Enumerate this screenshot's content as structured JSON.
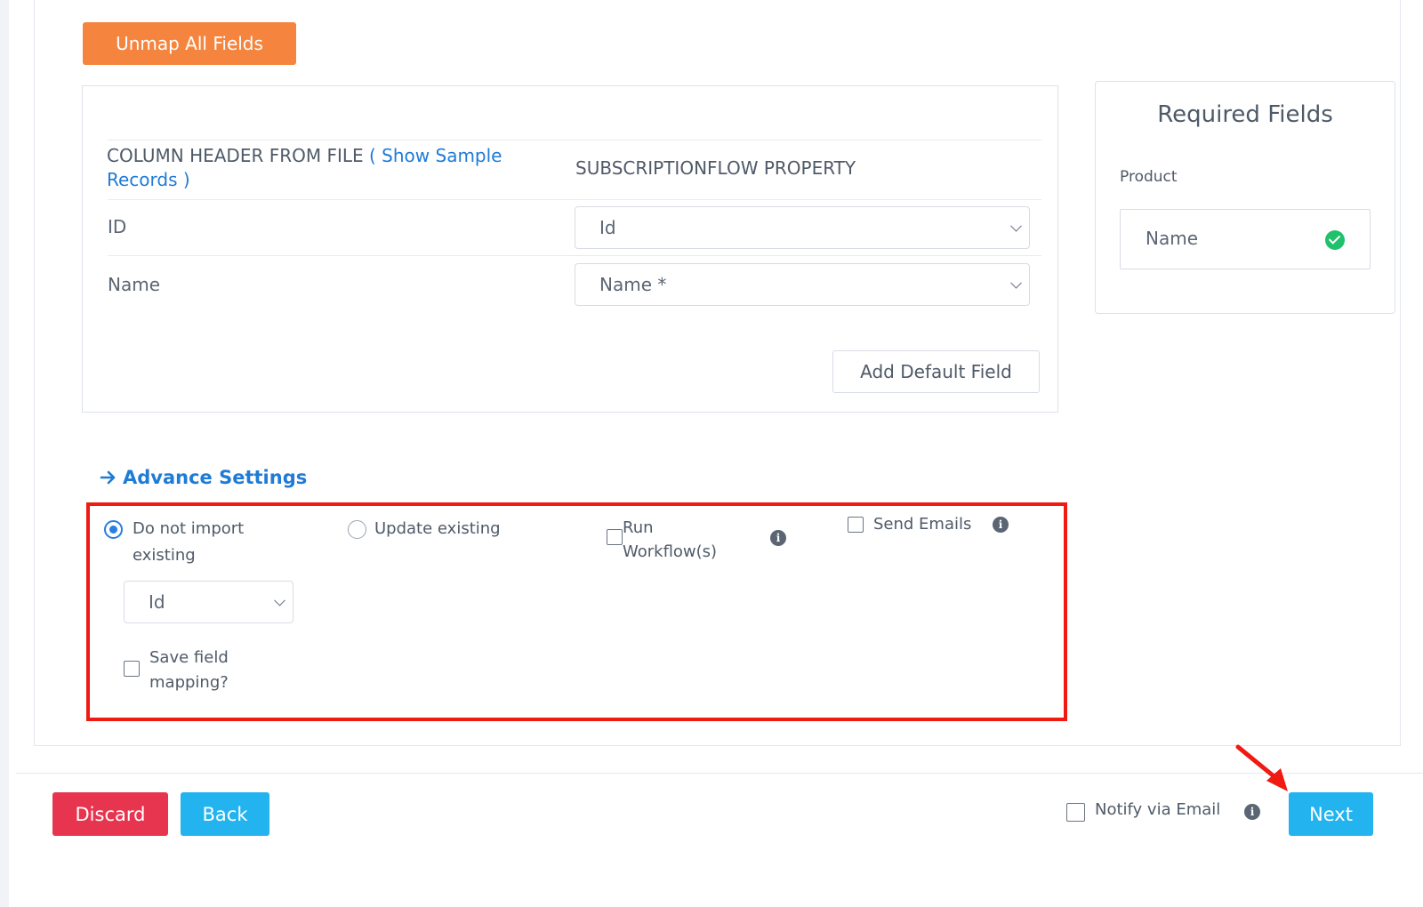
{
  "toolbar": {
    "unmap_label": "Unmap All Fields"
  },
  "mapping": {
    "col_header_prefix": "COLUMN HEADER FROM FILE",
    "col_header_link": "( Show Sample Records )",
    "property_header": "SUBSCRIPTIONFLOW PROPERTY",
    "rows": [
      {
        "file_column": "ID",
        "property": "Id"
      },
      {
        "file_column": "Name",
        "property": "Name *"
      }
    ],
    "add_default_label": "Add Default Field"
  },
  "required": {
    "title": "Required Fields",
    "entity": "Product",
    "fields": [
      {
        "name": "Name",
        "status": "mapped",
        "status_color": "#1fc16b"
      }
    ]
  },
  "advance": {
    "link_label": "Advance Settings",
    "options": {
      "do_not_import": {
        "label": "Do not import existing",
        "selected": true
      },
      "update_existing": {
        "label": "Update existing",
        "selected": false
      },
      "run_workflows": {
        "label": "Run Workflow(s)",
        "checked": false
      },
      "send_emails": {
        "label": "Send Emails",
        "checked": false
      },
      "match_field": {
        "value": "Id"
      },
      "save_mapping": {
        "label": "Save field mapping?",
        "checked": false
      }
    }
  },
  "footer": {
    "discard_label": "Discard",
    "back_label": "Back",
    "notify_label": "Notify via Email",
    "next_label": "Next"
  },
  "colors": {
    "unmap": "#f5853e",
    "discard": "#e8354f",
    "primary": "#23b4f0",
    "link": "#1e7bd6",
    "highlight": "#ef1a12"
  }
}
